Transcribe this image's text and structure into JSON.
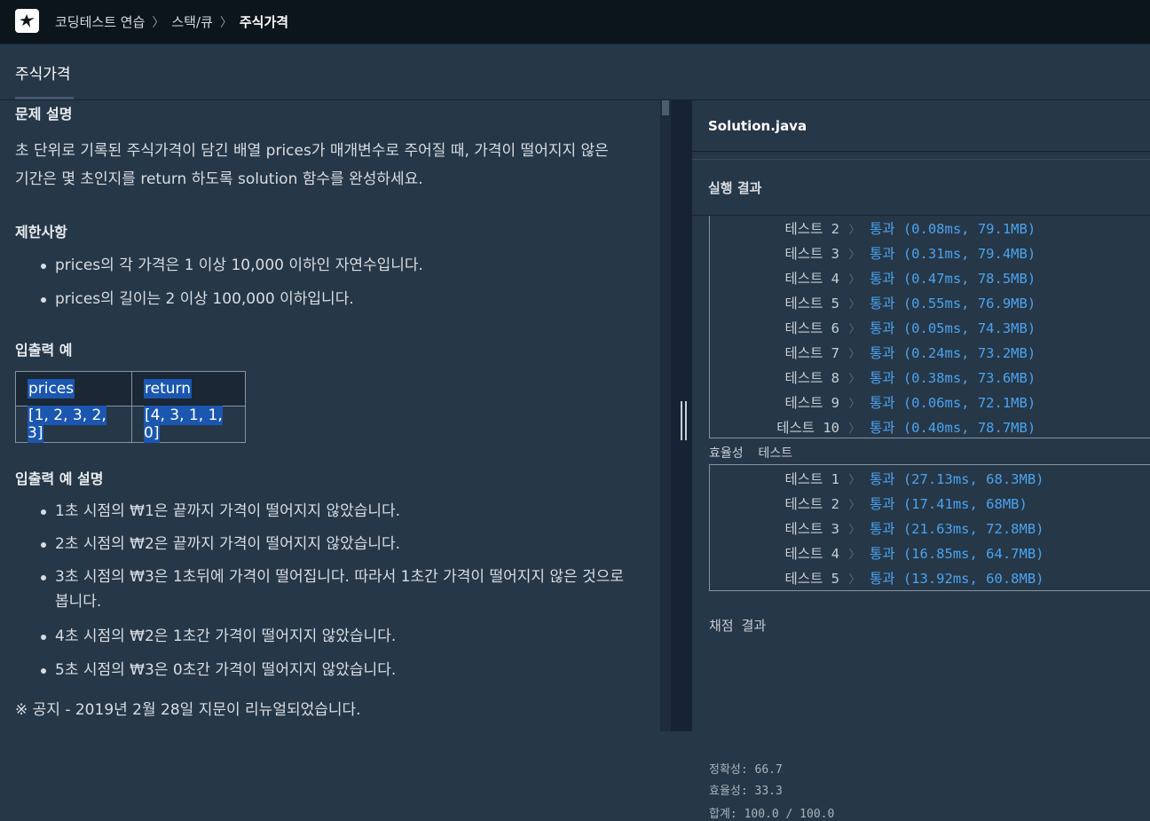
{
  "topbar": {
    "breadcrumbs": [
      "코딩테스트 연습",
      "스택/큐"
    ],
    "current": "주식가격"
  },
  "title": "주식가격",
  "problem": {
    "heading": "문제 설명",
    "desc_line1": "초 단위로 기록된 주식가격이 담긴 배열 prices가 매개변수로 주어질 때, 가격이 떨어지지 않은",
    "desc_line2": "기간은 몇 초인지를 return 하도록 solution 함수를 완성하세요.",
    "limits_heading": "제한사항",
    "limits": [
      "prices의 각 가격은 1 이상 10,000 이하인 자연수입니다.",
      "prices의 길이는 2 이상 100,000 이하입니다."
    ],
    "io_heading": "입출력 예",
    "io_table": {
      "headers": [
        "prices",
        "return"
      ],
      "rows": [
        [
          "[1, 2, 3, 2, 3]",
          "[4, 3, 1, 1, 0]"
        ]
      ]
    },
    "io_desc_heading": "입출력 예 설명",
    "io_desc": [
      "1초 시점의 ₩1은 끝까지 가격이 떨어지지 않았습니다.",
      "2초 시점의 ₩2은 끝까지 가격이 떨어지지 않았습니다.",
      "3초 시점의 ₩3은 1초뒤에 가격이 떨어집니다. 따라서 1초간 가격이 떨어지지 않은 것으로",
      "4초 시점의 ₩2은 1초간 가격이 떨어지지 않았습니다.",
      "5초 시점의 ₩3은 0초간 가격이 떨어지지 않았습니다."
    ],
    "io_desc_3_cont": "봅니다.",
    "notice": "※ 공지 - 2019년 2월 28일 지문이 리뉴얼되었습니다."
  },
  "editor": {
    "file_name": "Solution.java",
    "result_title": "실행 결과"
  },
  "accuracy_tests": [
    {
      "name": "테스트 2",
      "result": "통과 (0.08ms, 79.1MB)"
    },
    {
      "name": "테스트 3",
      "result": "통과 (0.31ms, 79.4MB)"
    },
    {
      "name": "테스트 4",
      "result": "통과 (0.47ms, 78.5MB)"
    },
    {
      "name": "테스트 5",
      "result": "통과 (0.55ms, 76.9MB)"
    },
    {
      "name": "테스트 6",
      "result": "통과 (0.05ms, 74.3MB)"
    },
    {
      "name": "테스트 7",
      "result": "통과 (0.24ms, 73.2MB)"
    },
    {
      "name": "테스트 8",
      "result": "통과 (0.38ms, 73.6MB)"
    },
    {
      "name": "테스트 9",
      "result": "통과 (0.06ms, 72.1MB)"
    },
    {
      "name": "테스트 10",
      "result": "통과 (0.40ms, 78.7MB)"
    }
  ],
  "efficiency_label": "효율성  테스트",
  "efficiency_tests": [
    {
      "name": "테스트 1",
      "result": "통과 (27.13ms, 68.3MB)"
    },
    {
      "name": "테스트 2",
      "result": "통과 (17.41ms, 68MB)"
    },
    {
      "name": "테스트 3",
      "result": "통과 (21.63ms, 72.8MB)"
    },
    {
      "name": "테스트 4",
      "result": "통과 (16.85ms, 64.7MB)"
    },
    {
      "name": "테스트 5",
      "result": "통과 (13.92ms, 60.8MB)"
    }
  ],
  "scoring": {
    "title": "채점 결과",
    "accuracy": "정확성: 66.7",
    "efficiency": "효율성: 33.3",
    "total": "합계: 100.0 / 100.0"
  },
  "icons": {
    "chevron": "〉",
    "breadcrumb_sep": "〉"
  }
}
